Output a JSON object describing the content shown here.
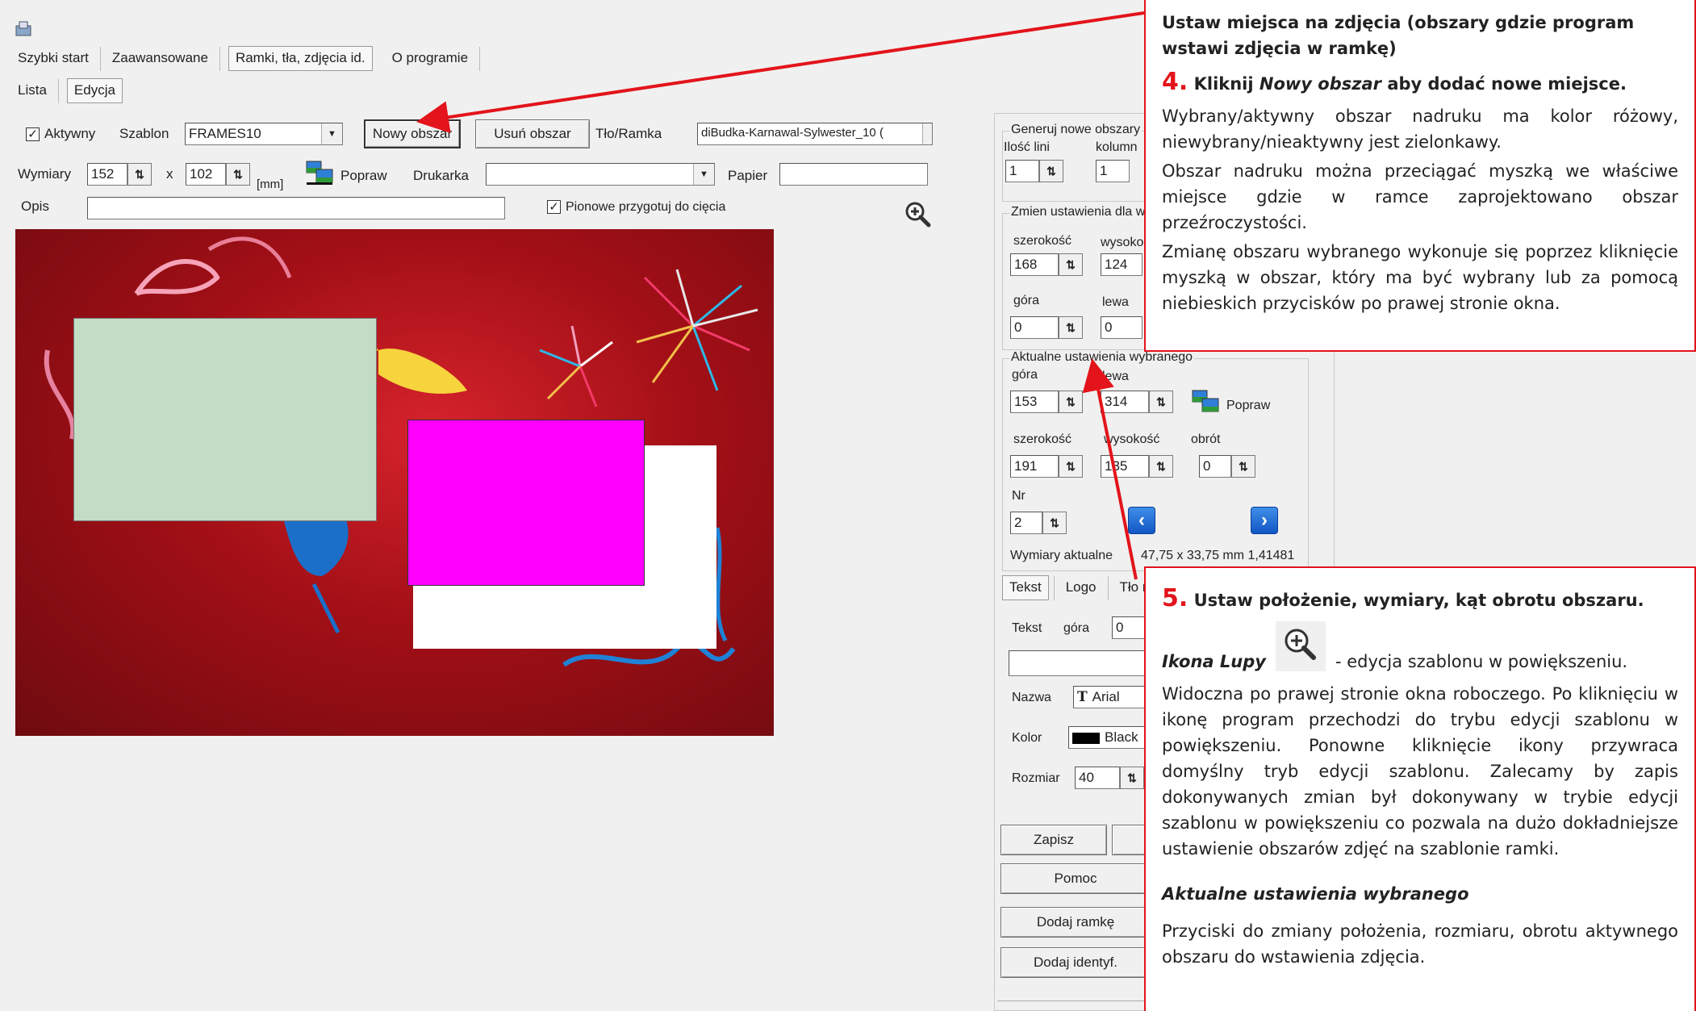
{
  "window": {
    "icon": "app-icon"
  },
  "main_tabs": [
    "Szybki start",
    "Zaawansowane",
    "Ramki, tła, zdjęcia id.",
    "O programie"
  ],
  "sub_tabs": [
    "Lista",
    "Edycja"
  ],
  "toolbar": {
    "aktywny": "Aktywny",
    "szablon_label": "Szablon",
    "szablon_value": "FRAMES10",
    "nowy_obszar": "Nowy obszar",
    "usun_obszar": "Usuń obszar",
    "tlo_ramka": "Tło/Ramka",
    "tlo_value": "diBudka-Karnawal-Sylwester_10 (",
    "wymiary_label": "Wymiary",
    "width": "152",
    "x": "x",
    "height": "102",
    "unit": "[mm]",
    "popraw": "Popraw",
    "drukarka": "Drukarka",
    "papier": "Papier",
    "opis": "Opis",
    "pionowe": "Pionowe przygotuj do cięcia"
  },
  "right_panel": {
    "generuj": {
      "title": "Generuj nowe obszary",
      "ilosc_lini": "Ilość lini",
      "kolumn": "kolumn",
      "v1": "1",
      "v2": "1"
    },
    "zmien": {
      "title": "Zmien ustawienia dla w",
      "szerokosc": "szerokość",
      "wysoko": "wysoko",
      "w_val": "168",
      "h_val": "124",
      "gora": "góra",
      "lewa": "lewa",
      "g_val": "0",
      "l_val": "0"
    },
    "aktualne": {
      "title": "Aktualne ustawienia wybranego",
      "gora": "góra",
      "lewa": "lewa",
      "g_val": "153",
      "l_val": "314",
      "popraw": "Popraw",
      "szerokosc": "szerokość",
      "wysokosc": "wysokość",
      "obrot": "obrót",
      "s_val": "191",
      "w_val": "135",
      "o_val": "0",
      "nr": "Nr",
      "nr_val": "2",
      "wymiary_akt": "Wymiary aktualne",
      "wymiary_val": "47,75 x 33,75 mm 1,41481"
    },
    "tabs": [
      "Tekst",
      "Logo",
      "Tło r"
    ],
    "tekst": {
      "tekst": "Tekst",
      "gora": "góra",
      "g_val": "0",
      "nazwa": "Nazwa",
      "font": "Arial",
      "kolor": "Kolor",
      "kolor_val": "Black",
      "rozmiar": "Rozmiar",
      "rozmiar_val": "40"
    },
    "buttons": {
      "zapisz": "Zapisz",
      "pomoc": "Pomoc",
      "dodaj_ramke": "Dodaj ramkę",
      "dodaj_identyf": "Dodaj identyf."
    }
  },
  "colors": {
    "selected_area": "#ff00ff",
    "unselected_area": "#c3dcc5",
    "annotation_border": "#e3141b",
    "nav_blue": "#1a6fd9"
  },
  "annotation_top": {
    "line1": "Ustaw miejsca na zdjęcia (obszary gdzie program wstawi zdjęcia w ramkę)",
    "num": "4.",
    "line2_a": "Kliknij ",
    "line2_em": "Nowy obszar",
    "line2_b": " aby dodać nowe miejsce.",
    "p1": "Wybrany/aktywny obszar nadruku ma kolor różowy, niewybrany/nieaktywny jest zielonkawy.",
    "p2": "Obszar nadruku można przeciągać myszką we właściwe miejsce gdzie w ramce zaprojektowano obszar przeźroczystości.",
    "p3": "Zmianę obszaru wybranego wykonuje się poprzez kliknięcie myszką w obszar, który ma być wybrany lub za pomocą niebieskich przycisków po prawej stronie okna."
  },
  "annotation_bottom": {
    "num": "5.",
    "title": "Ustaw położenie, wymiary, kąt obrotu obszaru.",
    "lupa_label": "Ikona Lupy",
    "lupa_desc": "- edycja szablonu w powiększeniu.",
    "p1": "Widoczna po prawej stronie okna roboczego. Po kliknięciu w ikonę program przechodzi do trybu edycji szablonu w powiększeniu. Ponowne kliknięcie ikony przywraca domyślny tryb edycji szablonu. Zalecamy by zapis dokonywanych zmian był dokonywany w trybie edycji szablonu w powiększeniu co pozwala na dużo dokładniejsze ustawienie obszarów zdjęć na szablonie ramki.",
    "aktualne_title": "Aktualne ustawienia wybranego",
    "p2": "Przyciski do zmiany położenia, rozmiaru, obrotu aktywnego obszaru do wstawienia zdjęcia."
  }
}
